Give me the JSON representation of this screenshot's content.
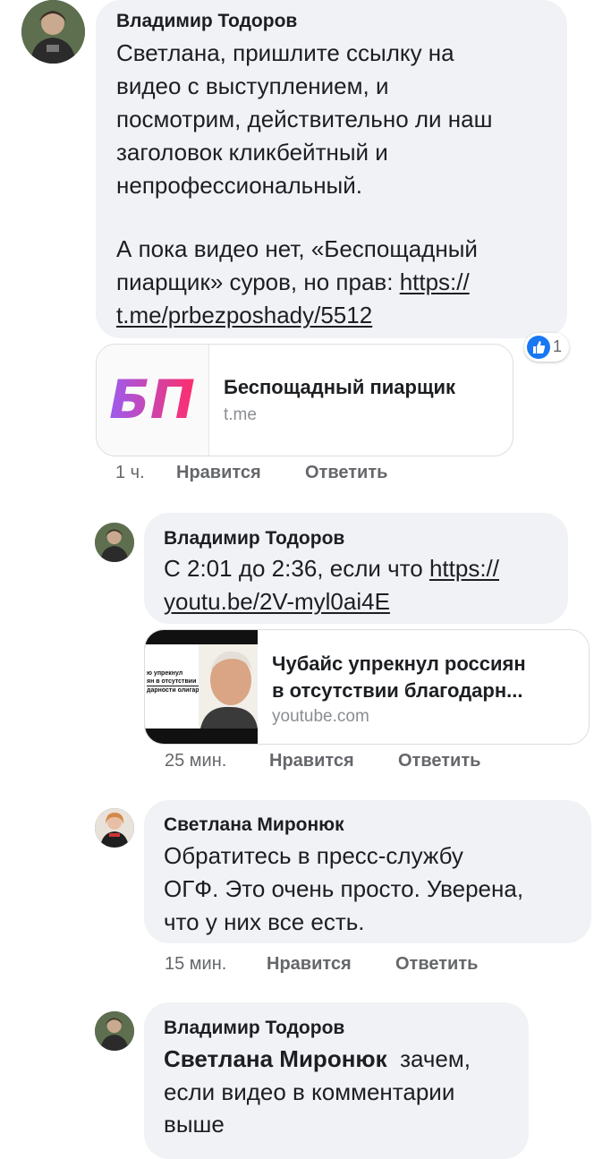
{
  "comments": [
    {
      "author": "Владимир Тодоров",
      "lines": [
        "Светлана, пришлите ссылку на",
        "видео с выступлением, и",
        "посмотрим, действительно ли наш",
        "заголовок кликбейтный и",
        "непрофессиональный.",
        "А пока видео нет, «Беспощадный",
        "пиарщик» суров, но прав: "
      ],
      "link_part1": "https://",
      "link_part2": "t.me/prbezposhady/5512",
      "reaction_count": "1",
      "card": {
        "logo": "БП",
        "title": "Беспощадный пиарщик",
        "domain": "t.me"
      },
      "time": "1 ч.",
      "like": "Нравится",
      "reply": "Ответить"
    },
    {
      "author": "Владимир Тодоров",
      "text": "С 2:01 до 2:36, если что ",
      "link_part1": "https://",
      "link_part2": "youtu.be/2V-myl0ai4E",
      "card": {
        "thumb_text": [
          "ю упрекнул",
          "ян в отсутствии",
          "дарности олигархам"
        ],
        "title_line1": "Чубайс упрекнул россиян",
        "title_line2": "в отсутствии благодарн...",
        "domain": "youtube.com"
      },
      "time": "25 мин.",
      "like": "Нравится",
      "reply": "Ответить"
    },
    {
      "author": "Светлана Миронюк",
      "lines": [
        "Обратитесь в пресс-службу",
        "ОГФ. Это очень просто. Уверена,",
        "что у них все есть."
      ],
      "time": "15 мин.",
      "like": "Нравится",
      "reply": "Ответить"
    },
    {
      "author": "Владимир Тодоров",
      "mention": "Светлана Миронюк",
      "text_after_mention": "зачем,",
      "lines": [
        "если видео в комментарии",
        "выше"
      ]
    }
  ],
  "colors": {
    "bubble": "#f0f2f5",
    "link": "#1c1e21",
    "meta": "#65676b",
    "like_blue": "#1877f2"
  }
}
